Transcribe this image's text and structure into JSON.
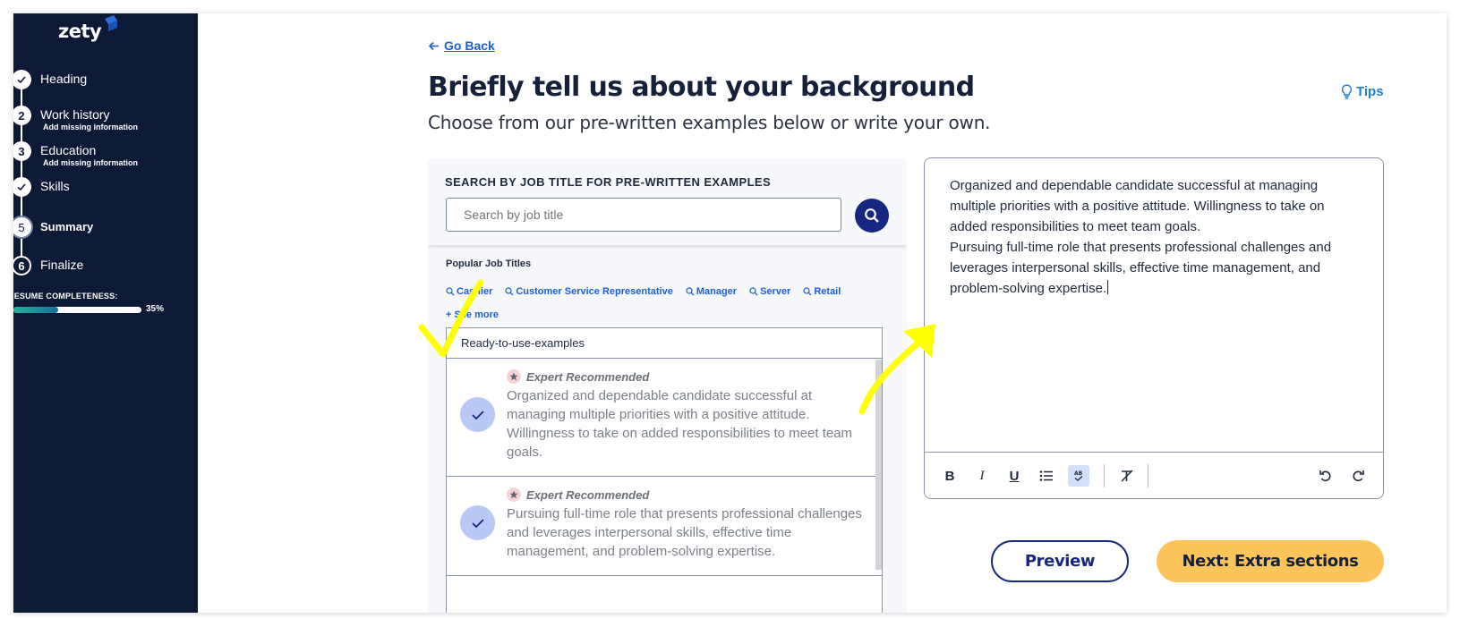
{
  "sidebar": {
    "logo": "zety",
    "steps": [
      {
        "number": "",
        "label": "Heading",
        "sub": "",
        "state": "done"
      },
      {
        "number": "2",
        "label": "Work history",
        "sub": "Add missing information",
        "state": "todo"
      },
      {
        "number": "3",
        "label": "Education",
        "sub": "Add missing information",
        "state": "todo"
      },
      {
        "number": "",
        "label": "Skills",
        "sub": "",
        "state": "done"
      },
      {
        "number": "5",
        "label": "Summary",
        "sub": "",
        "state": "current"
      },
      {
        "number": "6",
        "label": "Finalize",
        "sub": "",
        "state": "todo"
      }
    ],
    "completeness_label": "RESUME COMPLETENESS:",
    "completeness_value": 0.35,
    "completeness_text": "35%"
  },
  "header": {
    "go_back": "Go Back",
    "title": "Briefly tell us about your background",
    "subtitle": "Choose from our pre-written examples below or write your own.",
    "tips": "Tips"
  },
  "search": {
    "title": "SEARCH BY JOB TITLE FOR PRE-WRITTEN EXAMPLES",
    "placeholder": "Search by job title",
    "popular_label": "Popular Job Titles",
    "popular": [
      "Cashier",
      "Customer Service Representative",
      "Manager",
      "Server",
      "Retail"
    ],
    "see_more": "+ See more"
  },
  "examples": {
    "header": "Ready-to-use-examples",
    "items": [
      {
        "badge": "Expert Recommended",
        "text": "Organized and dependable candidate successful at managing multiple priorities with a positive attitude. Willingness to take on added responsibilities to meet team goals.",
        "selected": true
      },
      {
        "badge": "Expert Recommended",
        "text": "Pursuing full-time role that presents professional challenges and leverages interpersonal skills, effective time management, and problem-solving expertise.",
        "selected": true
      }
    ]
  },
  "editor": {
    "paragraphs": [
      "Organized and dependable candidate successful at managing multiple priorities with a positive attitude. Willingness to take on added responsibilities to meet team goals.",
      "Pursuing full-time role that presents professional challenges and leverages interpersonal skills, effective time management, and problem-solving expertise."
    ],
    "toolbar": {
      "bold": "B",
      "italic": "I",
      "underline": "U"
    }
  },
  "buttons": {
    "preview": "Preview",
    "next": "Next: Extra sections"
  },
  "colors": {
    "sidebar": "#0c1a35",
    "primary": "#172781",
    "accent": "#fcc45a",
    "link": "#1a5fd6",
    "annotation": "#ffff00"
  }
}
